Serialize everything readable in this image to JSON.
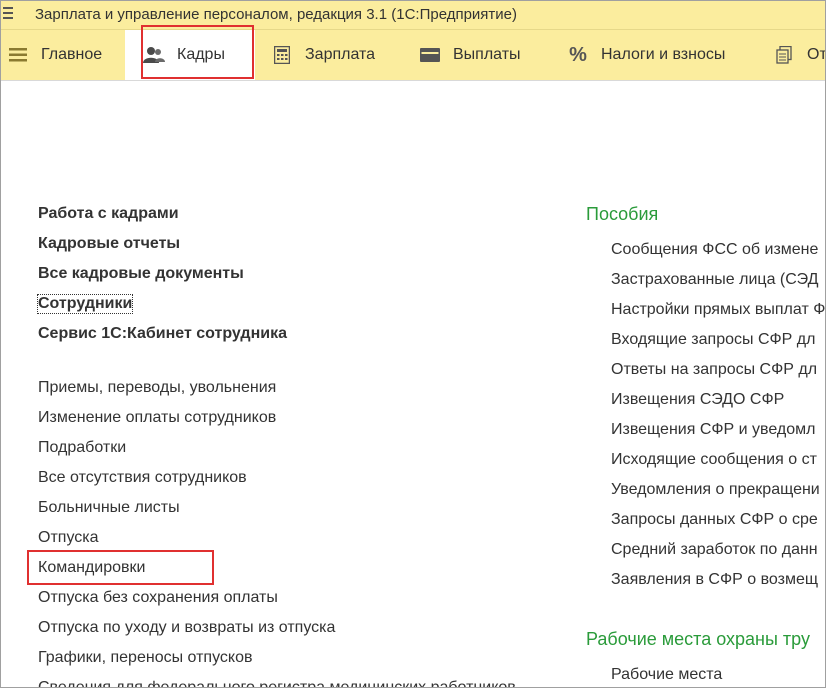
{
  "window": {
    "title": "Зарплата и управление персоналом, редакция 3.1  (1С:Предприятие)"
  },
  "tabs": [
    {
      "label": "Главное",
      "icon": "menu-lines-icon"
    },
    {
      "label": "Кадры",
      "icon": "people-icon",
      "active": true
    },
    {
      "label": "Зарплата",
      "icon": "calculator-icon"
    },
    {
      "label": "Выплаты",
      "icon": "wallet-icon"
    },
    {
      "label": "Налоги и взносы",
      "icon": "percent-icon"
    },
    {
      "label": "От",
      "icon": "documents-icon"
    }
  ],
  "left": {
    "bold_items": [
      "Работа с кадрами",
      "Кадровые отчеты",
      "Все кадровые документы",
      "Сотрудники",
      "Сервис 1С:Кабинет сотрудника"
    ],
    "items": [
      "Приемы, переводы, увольнения",
      "Изменение оплаты сотрудников",
      "Подработки",
      "Все отсутствия сотрудников",
      "Больничные листы",
      "Отпуска",
      "Командировки",
      "Отпуска без сохранения оплаты",
      "Отпуска по уходу и возвраты из отпуска",
      "Графики, переносы отпусков",
      "Сведения для федерального регистра медицинских работников"
    ]
  },
  "right": {
    "section1_title": "Пособия",
    "section1_items": [
      "Сообщения ФСС об измене",
      "Застрахованные лица (СЭД",
      "Настройки прямых выплат Ф",
      "Входящие запросы СФР дл",
      "Ответы на запросы СФР дл",
      "Извещения СЭДО СФР",
      "Извещения СФР и уведомл",
      "Исходящие сообщения о ст",
      "Уведомления о прекращени",
      "Запросы данных СФР о сре",
      "Средний заработок по данн",
      "Заявления в СФР о возмещ"
    ],
    "section2_title": "Рабочие места охраны тру",
    "section2_items": [
      "Рабочие места"
    ]
  },
  "colors": {
    "header_bg": "#fbed9e",
    "section_green": "#2a9b3a",
    "highlight_red": "#e03030"
  }
}
